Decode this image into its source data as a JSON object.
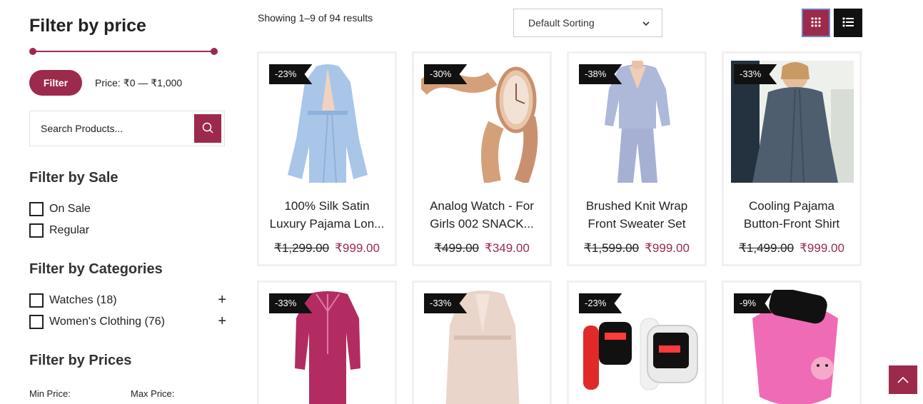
{
  "sidebar": {
    "filter_price_title": "Filter by price",
    "filter_button": "Filter",
    "price_label": "Price:",
    "price_range": "₹0 — ₹1,000",
    "search_placeholder": "Search Products...",
    "filter_sale_title": "Filter by Sale",
    "sale_options": [
      "On Sale",
      "Regular"
    ],
    "filter_categories_title": "Filter by Categories",
    "categories": [
      "Watches (18)",
      "Women's Clothing (76)"
    ],
    "filter_prices_title": "Filter by Prices",
    "min_price_label": "Min Price:",
    "max_price_label": "Max Price:"
  },
  "toolbar": {
    "results_text": "Showing 1–9 of 94 results",
    "sort_value": "Default Sorting"
  },
  "products": [
    {
      "badge": "-23%",
      "name1": "100% Silk Satin",
      "name2": "Luxury Pajama Lon...",
      "old_price": "₹1,299.00",
      "new_price": "₹999.00"
    },
    {
      "badge": "-30%",
      "name1": "Analog Watch - For",
      "name2": "Girls 002 SNACK...",
      "old_price": "₹499.00",
      "new_price": "₹349.00"
    },
    {
      "badge": "-38%",
      "name1": "Brushed Knit Wrap",
      "name2": "Front Sweater Set",
      "old_price": "₹1,599.00",
      "new_price": "₹999.00"
    },
    {
      "badge": "-33%",
      "name1": "Cooling Pajama",
      "name2": "Button-Front Shirt",
      "old_price": "₹1,499.00",
      "new_price": "₹999.00"
    },
    {
      "badge": "-33%"
    },
    {
      "badge": "-33%"
    },
    {
      "badge": "-23%"
    },
    {
      "badge": "-9%"
    }
  ],
  "colors": {
    "accent": "#9c2a4b",
    "dark": "#111111",
    "border": "#f1f1f1"
  }
}
